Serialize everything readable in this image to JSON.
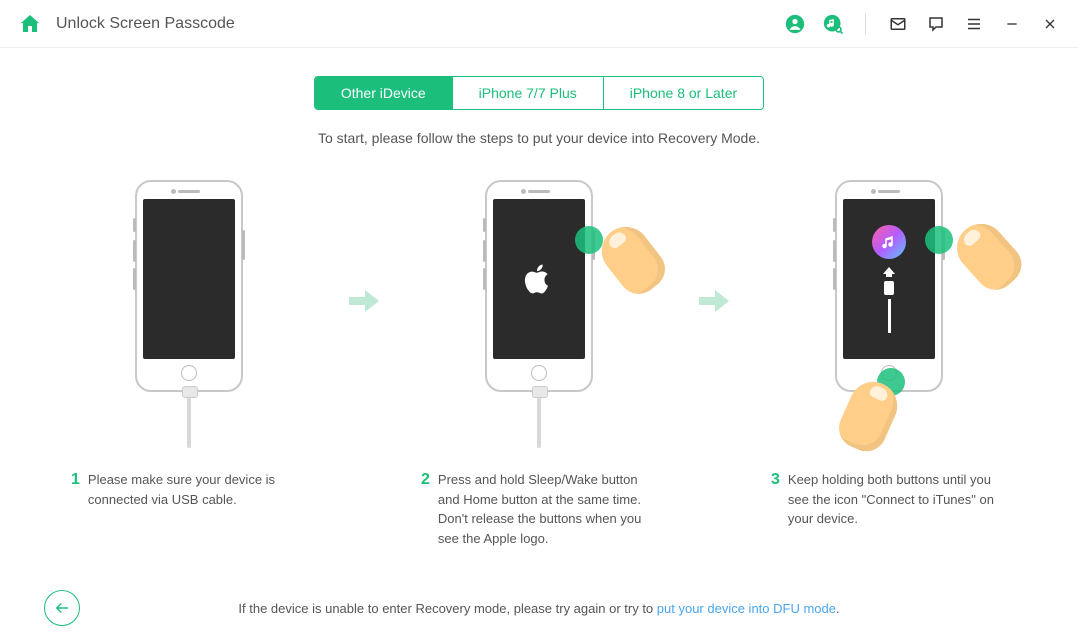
{
  "header": {
    "title": "Unlock Screen Passcode"
  },
  "tabs": [
    {
      "label": "Other iDevice",
      "active": true
    },
    {
      "label": "iPhone 7/7 Plus",
      "active": false
    },
    {
      "label": "iPhone 8 or Later",
      "active": false
    }
  ],
  "subtitle": "To start, please follow the steps to put your device into Recovery Mode.",
  "steps": [
    {
      "num": "1",
      "text": "Please make sure your device is connected via USB cable."
    },
    {
      "num": "2",
      "text": "Press and hold Sleep/Wake button and Home button at the same time. Don't release the buttons when you see the Apple logo."
    },
    {
      "num": "3",
      "text": "Keep holding both buttons until you see the icon \"Connect to iTunes\" on your device."
    }
  ],
  "footer": {
    "text_prefix": "If the device is unable to enter Recovery mode, please try again or try to ",
    "link_text": "put your device into DFU mode",
    "text_suffix": "."
  }
}
